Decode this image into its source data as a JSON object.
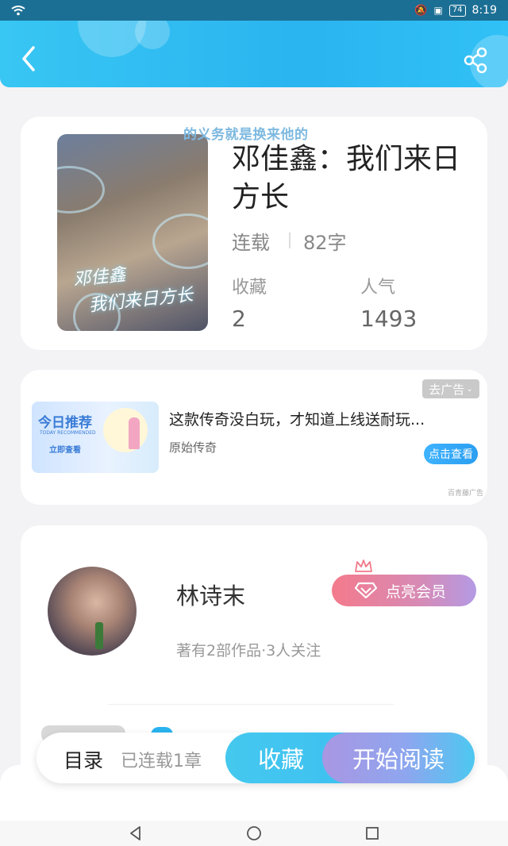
{
  "status_bar": {
    "time": "8:19",
    "battery": "74"
  },
  "book": {
    "marquee": "的义务就是换来他的",
    "title": "邓佳鑫：我们来日方长",
    "cover_text_line1": "邓佳鑫",
    "cover_text_line2": "我们来日方长",
    "status": "连载",
    "word_count": "82字",
    "favorites_label": "收藏",
    "favorites_value": "2",
    "popularity_label": "人气",
    "popularity_value": "1493"
  },
  "ad": {
    "close_label": "去广告",
    "image_title": "今日推荐",
    "image_subtitle": "TODAY RECOMMENDED",
    "image_button": "立即查看",
    "title": "这款传奇没白玩，才知道上线送耐玩...",
    "source": "原始传奇",
    "cta": "点击查看",
    "mark": "百青藤广告"
  },
  "author": {
    "name": "林诗末",
    "vip_label": "点亮会员",
    "meta": "著有2部作品·3人关注"
  },
  "bottom_bar": {
    "catalog": "目录",
    "chapters": "已连载1章",
    "collect": "收藏",
    "read": "开始阅读"
  },
  "colors": {
    "accent": "#2ab4f0",
    "vip_start": "#f47a8c",
    "vip_end": "#b49ae4"
  }
}
